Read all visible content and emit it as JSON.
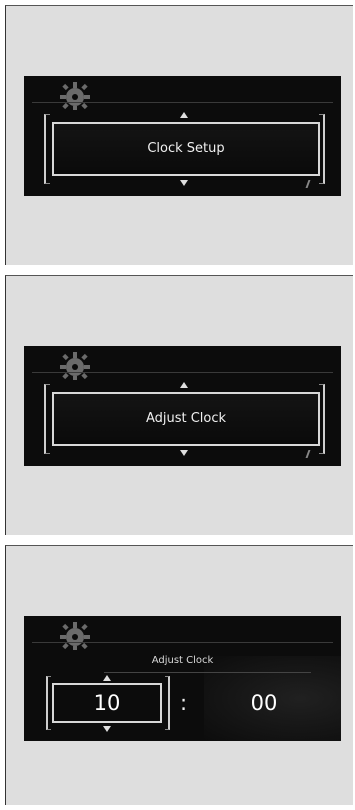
{
  "screens": [
    {
      "menu_label": "Clock Setup"
    },
    {
      "menu_label": "Adjust Clock"
    },
    {
      "title": "Adjust Clock",
      "hour": "10",
      "separator": ":",
      "minute": "00"
    }
  ],
  "icons": {
    "settings": "gear-icon",
    "scroll_up": "triangle-up-icon",
    "scroll_down": "triangle-down-icon"
  },
  "colors": {
    "screen_background": "#0c0c0c",
    "frame_background": "#dedede",
    "text": "#f0f0f0",
    "selection_border": "#d8d8d8"
  }
}
